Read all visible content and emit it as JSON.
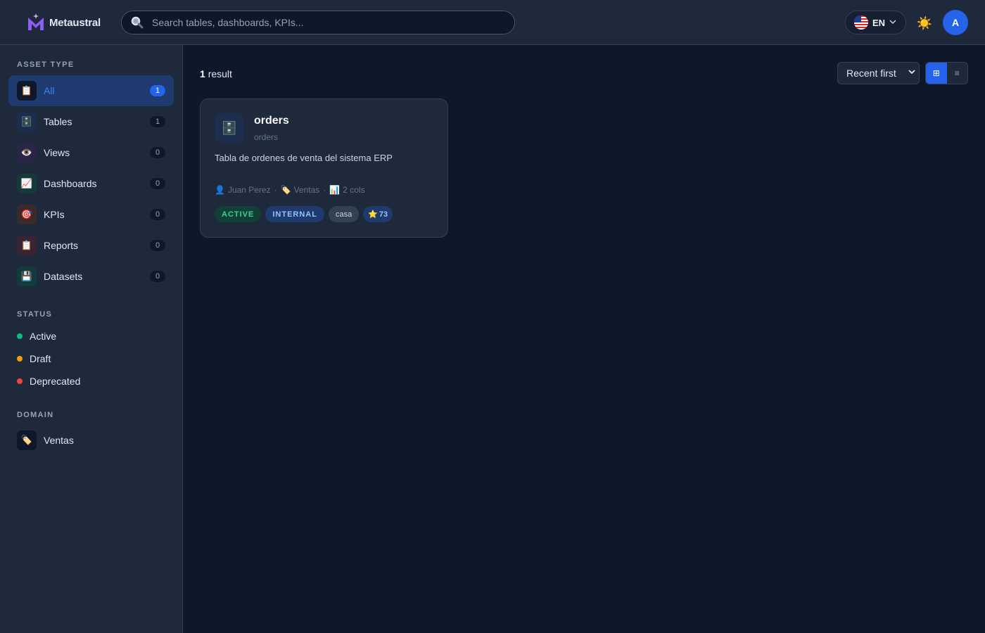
{
  "header": {
    "logo_text": "Metaustral",
    "search_placeholder": "Search tables, dashboards, KPIs...",
    "language_code": "EN",
    "avatar_initial": "A",
    "icons": {
      "search": "magnifier-icon",
      "theme": "sun-icon",
      "flag": "us-flag-icon",
      "chevron": "chevron-down-icon"
    }
  },
  "sidebar": {
    "asset_type_title": "ASSET TYPE",
    "asset_types": [
      {
        "label": "All",
        "count": "1",
        "icon": "📋",
        "icon_name": "clipboard-icon",
        "active": true
      },
      {
        "label": "Tables",
        "count": "1",
        "icon": "🗄️",
        "icon_name": "file-cabinet-icon",
        "active": false
      },
      {
        "label": "Views",
        "count": "0",
        "icon": "👁️",
        "icon_name": "eye-icon",
        "active": false
      },
      {
        "label": "Dashboards",
        "count": "0",
        "icon": "📈",
        "icon_name": "chart-up-icon",
        "active": false
      },
      {
        "label": "KPIs",
        "count": "0",
        "icon": "🎯",
        "icon_name": "target-icon",
        "active": false
      },
      {
        "label": "Reports",
        "count": "0",
        "icon": "📋",
        "icon_name": "clipboard-icon",
        "active": false
      },
      {
        "label": "Datasets",
        "count": "0",
        "icon": "💾",
        "icon_name": "floppy-disk-icon",
        "active": false
      }
    ],
    "status_title": "STATUS",
    "statuses": [
      {
        "label": "Active",
        "color": "#10b981"
      },
      {
        "label": "Draft",
        "color": "#f59e0b"
      },
      {
        "label": "Deprecated",
        "color": "#ef4444"
      }
    ],
    "domain_title": "DOMAIN",
    "domains": [
      {
        "label": "Ventas",
        "icon": "🏷️",
        "icon_name": "tag-icon"
      }
    ]
  },
  "main": {
    "result_count": "1",
    "result_label": "result",
    "sort_selected": "Recent first",
    "view_mode": "grid",
    "view_icons": {
      "grid": "⊞",
      "list": "≡"
    },
    "cards": [
      {
        "title": "orders",
        "subtitle": "orders",
        "description": "Tabla de ordenes de venta del sistema ERP",
        "owner": "Juan Perez",
        "domain": "Ventas",
        "columns": "2 cols",
        "icon": "🗄️",
        "status_tag": "ACTIVE",
        "visibility_tag": "INTERNAL",
        "tag": "casa",
        "score": "73"
      }
    ]
  },
  "colors": {
    "accent": "#2563eb",
    "background": "#0f172a",
    "surface": "#1e293b",
    "border": "#334155"
  }
}
